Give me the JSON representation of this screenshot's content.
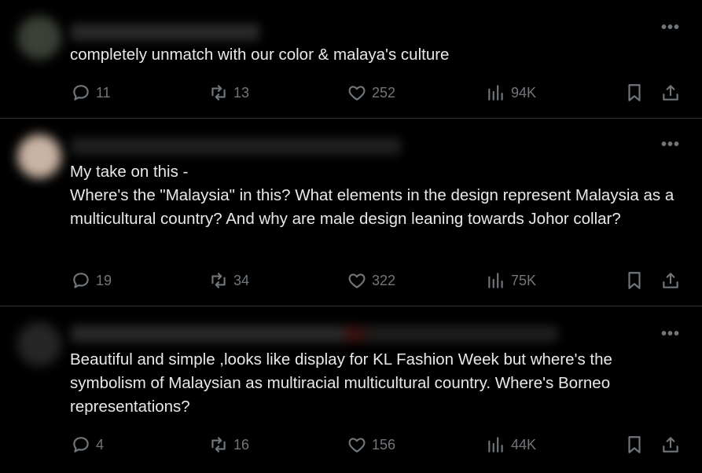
{
  "posts": [
    {
      "text": "completely unmatch with our color & malaya's culture",
      "replies": "11",
      "reposts": "13",
      "likes": "252",
      "views": "94K"
    },
    {
      "text": "My take on this -\nWhere's the \"Malaysia\" in this? What elements in the design represent Malaysia as a multicultural country? And why are male design leaning towards Johor collar?",
      "replies": "19",
      "reposts": "34",
      "likes": "322",
      "views": "75K"
    },
    {
      "text": "Beautiful and simple ,looks like display for KL Fashion Week but where's the symbolism of Malaysian as multiracial multicultural country.  Where's Borneo representations?",
      "replies": "4",
      "reposts": "16",
      "likes": "156",
      "views": "44K"
    }
  ],
  "icons": {
    "more": "more-icon",
    "reply": "reply-icon",
    "repost": "repost-icon",
    "like": "heart-icon",
    "views": "views-icon",
    "bookmark": "bookmark-icon",
    "share": "share-icon"
  },
  "more_glyph": "•••",
  "colors": {
    "background": "#000000",
    "text": "#e7e9ea",
    "muted": "#71767b",
    "divider": "#2f3336"
  }
}
